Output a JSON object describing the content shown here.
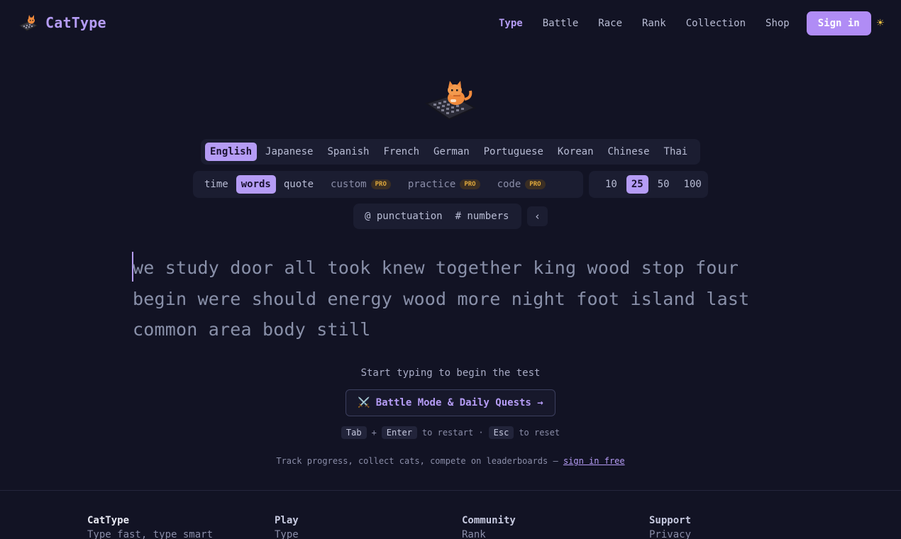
{
  "header": {
    "logo_text": "CatType",
    "nav": [
      "Type",
      "Battle",
      "Race",
      "Rank",
      "Collection",
      "Shop"
    ],
    "active_nav": "Type",
    "signin_label": "Sign in",
    "theme_icon": "sun-icon"
  },
  "languages": [
    "English",
    "Japanese",
    "Spanish",
    "French",
    "German",
    "Portuguese",
    "Korean",
    "Chinese",
    "Thai"
  ],
  "selected_language": "English",
  "modes": [
    {
      "label": "time",
      "pro": false
    },
    {
      "label": "words",
      "pro": false
    },
    {
      "label": "quote",
      "pro": false
    },
    {
      "label": "custom",
      "pro": true
    },
    {
      "label": "practice",
      "pro": true
    },
    {
      "label": "code",
      "pro": true
    }
  ],
  "selected_mode": "words",
  "pro_badge": "PRO",
  "counts": [
    "10",
    "25",
    "50",
    "100"
  ],
  "selected_count": "25",
  "options": {
    "punctuation": "@ punctuation",
    "numbers": "# numbers",
    "collapse": "‹"
  },
  "test_words": "we study door all took knew together king wood stop four begin were should energy wood more night foot island last common area body still",
  "hint": "Start typing to begin the test",
  "battle_button": {
    "icon": "⚔️",
    "label": "Battle Mode & Daily Quests →"
  },
  "shortcuts": {
    "key1": "Tab",
    "plus": "+",
    "key2": "Enter",
    "text1": "to restart ·",
    "key3": "Esc",
    "text2": "to reset"
  },
  "track": {
    "text": "Track progress, collect cats, compete on leaderboards —",
    "link": "sign in free"
  },
  "footer": {
    "brand": "CatType",
    "tagline": "Type fast, type smart",
    "columns": [
      {
        "title": "Play",
        "first": "Type"
      },
      {
        "title": "Community",
        "first": "Rank"
      },
      {
        "title": "Support",
        "first": "Privacy"
      }
    ]
  },
  "colors": {
    "background": "#121324",
    "accent": "#b59cf5",
    "pro": "#e0a93b"
  }
}
